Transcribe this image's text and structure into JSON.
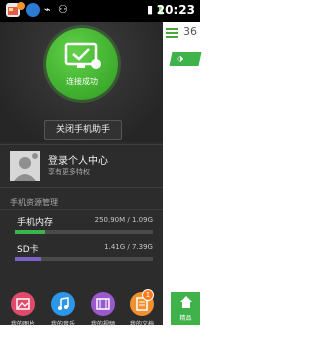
{
  "status_bar": {
    "time": "20:23",
    "icons": [
      "app-icon-1",
      "browser-icon",
      "usb-icon",
      "android-icon",
      "signal-icon",
      "battery-icon"
    ]
  },
  "hero": {
    "connection_status": "连接成功",
    "close_button_label": "关闭手机助手"
  },
  "user_center": {
    "title": "登录个人中心",
    "subtitle": "享有更多特权"
  },
  "resources": {
    "section_title": "手机资源管理",
    "items": [
      {
        "name": "手机内存",
        "value": "250.90M / 1.09G",
        "used_fraction": 0.22,
        "color": "#3cb44b"
      },
      {
        "name": "SD卡",
        "value": "1.41G / 7.39G",
        "used_fraction": 0.19,
        "color": "#7b63c6"
      }
    ]
  },
  "apps": [
    {
      "label": "我的图片",
      "icon": "pictures-icon",
      "color": "#e24a6b"
    },
    {
      "label": "我的音乐",
      "icon": "music-icon",
      "color": "#2d96e6"
    },
    {
      "label": "我的视频",
      "icon": "video-icon",
      "color": "#9b59d0"
    },
    {
      "label": "我的文档",
      "icon": "document-icon",
      "color": "#f0902e",
      "badge": "1"
    }
  ],
  "right_panel": {
    "count": "36",
    "featured_label": "精品"
  },
  "colors": {
    "accent": "#3fb24a",
    "drawer_bg": "#2c2c2c"
  }
}
